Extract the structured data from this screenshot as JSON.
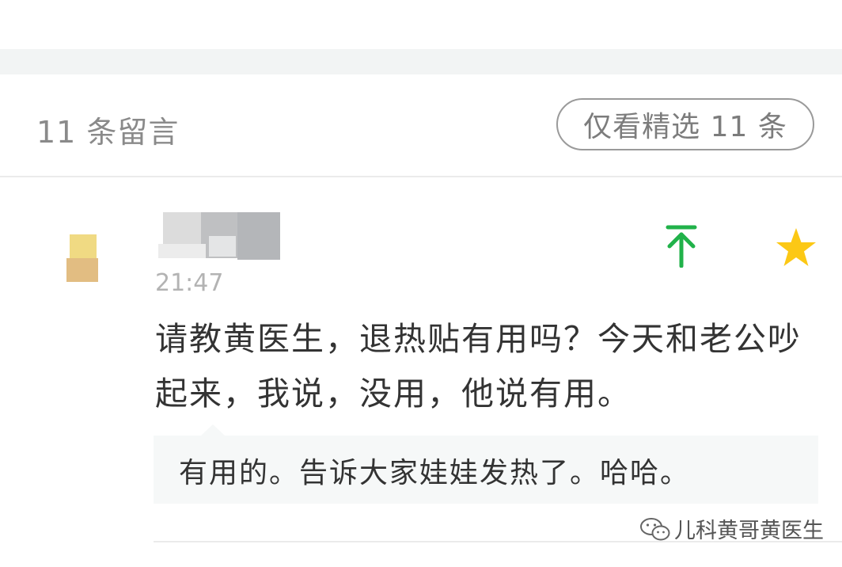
{
  "header": {
    "comment_count_label": "11 条留言",
    "filter_label": "仅看精选 11 条"
  },
  "comment": {
    "time": "21:47",
    "text": "请教黄医生，退热贴有用吗？今天和老公吵起来，我说，没用，他说有用。",
    "reply": "有用的。告诉大家娃娃发热了。哈哈。",
    "pin_icon": "pin-to-top-icon",
    "star_icon": "star-icon",
    "pin_color": "#21b24a",
    "star_color": "#fcc815"
  },
  "watermark": {
    "label": "儿科黄哥黄医生",
    "icon": "wechat-logo-icon"
  }
}
